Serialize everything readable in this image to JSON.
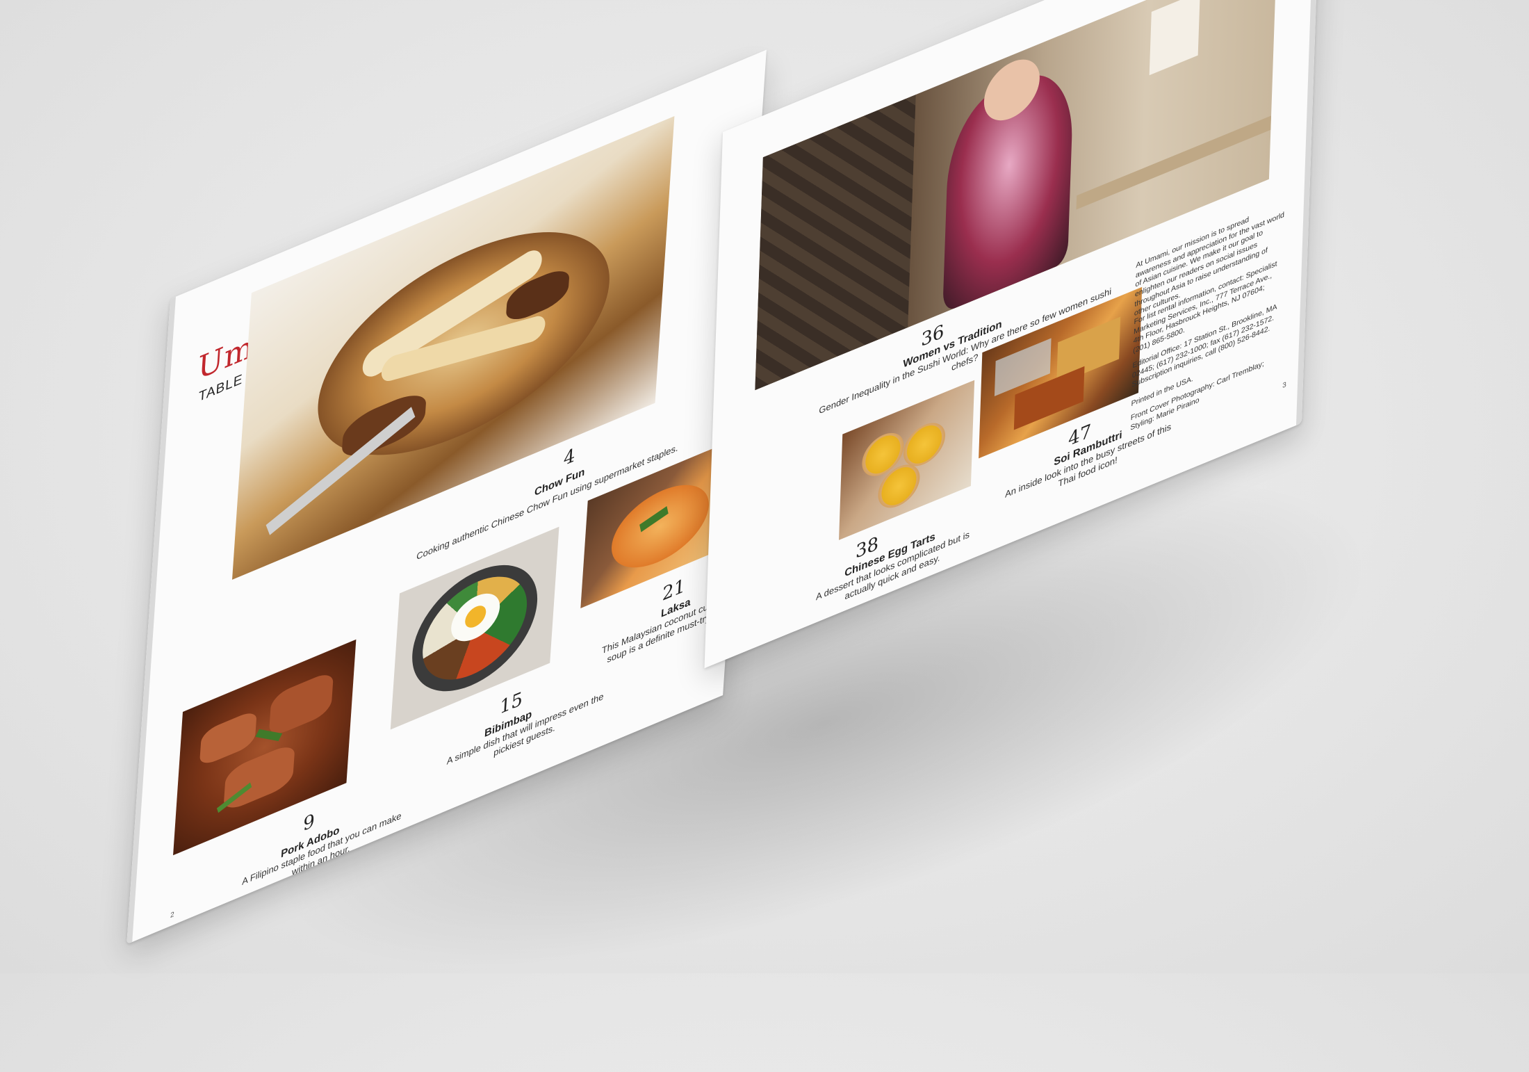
{
  "magazine": {
    "brand": "Umami",
    "section": "TABLE OF CONTENTS"
  },
  "toc": [
    {
      "page": "4",
      "title": "Chow Fun",
      "desc": "Cooking authentic Chinese Chow Fun using supermarket staples."
    },
    {
      "page": "9",
      "title": "Pork Adobo",
      "desc": "A Filipino staple food that you can make within an hour."
    },
    {
      "page": "15",
      "title": "Bibimbap",
      "desc": "A simple dish that will impress even the pickiest guests."
    },
    {
      "page": "21",
      "title": "Laksa",
      "desc": "This Malaysian coconut curry soup is a definite must-try."
    },
    {
      "page": "36",
      "title": "Women vs Tradition",
      "desc": "Gender Inequality in the Sushi World: Why are there so few women sushi chefs?"
    },
    {
      "page": "38",
      "title": "Chinese Egg Tarts",
      "desc": "A dessert that looks complicated but is actually quick and easy."
    },
    {
      "page": "47",
      "title": "Soi Rambuttri",
      "desc": "An inside look into the busy streets of this Thai food icon!"
    }
  ],
  "masthead": {
    "mission": "At Umami, our mission is to spread awareness and appreciation for the vast world of Asian cuisine. We make it our goal to enlighten our readers on social issues throughout Asia to raise understanding of other cultures.",
    "rental": "For list rental information, contact: Specialist Marketing Services, Inc., 777 Terrace Ave., 4th Floor, Hasbrouck Heights, NJ 07604; (201) 865-5800.",
    "editorial": "Editorial Office: 17 Station St., Brookline, MA 02445; (617) 232-1000; fax (617) 232-1572. Subscription inquiries, call (800) 526-8442.",
    "printed": "Printed in the USA.",
    "credits": "Front Cover Photography: Carl Tremblay; Styling: Marie Piraino"
  },
  "page_numbers": {
    "left": "2",
    "right": "3"
  },
  "colors": {
    "brand": "#c1272d",
    "paper": "#fbfbfb",
    "background": "#e6e6e6"
  }
}
